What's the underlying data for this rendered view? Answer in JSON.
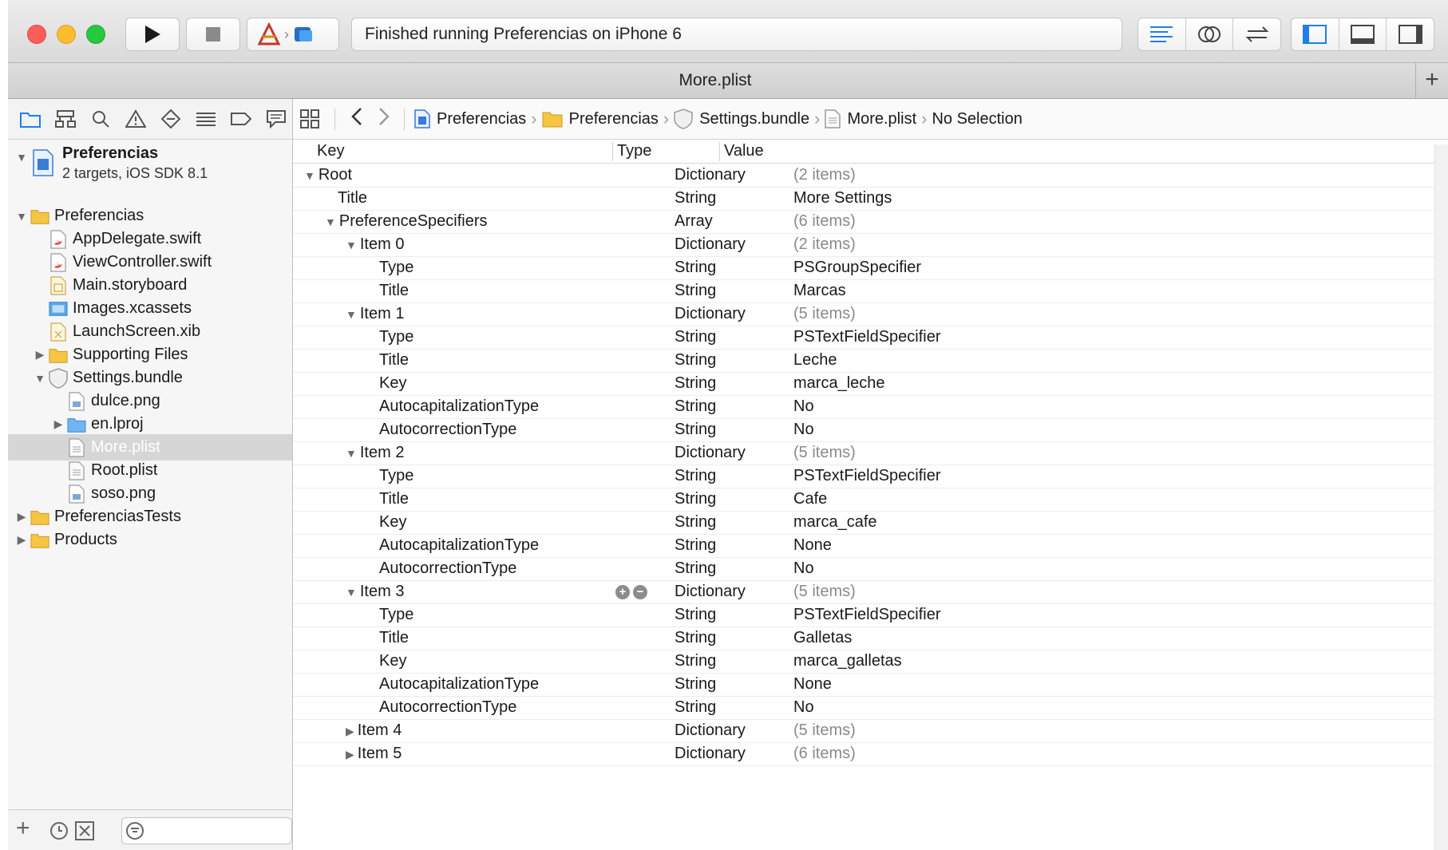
{
  "toolbar": {
    "activity_text": "Finished running Preferencias on iPhone 6"
  },
  "tab": {
    "title": "More.plist",
    "add_label": "+"
  },
  "navigator": {
    "project": {
      "name": "Preferencias",
      "subtitle": "2 targets, iOS SDK 8.1"
    },
    "items": [
      {
        "label": "Preferencias",
        "level": 1,
        "icon": "folder-icon",
        "disclosure": "open"
      },
      {
        "label": "AppDelegate.swift",
        "level": 2,
        "icon": "swift-file-icon",
        "disclosure": "none"
      },
      {
        "label": "ViewController.swift",
        "level": 2,
        "icon": "swift-file-icon",
        "disclosure": "none"
      },
      {
        "label": "Main.storyboard",
        "level": 2,
        "icon": "storyboard-icon",
        "disclosure": "none"
      },
      {
        "label": "Images.xcassets",
        "level": 2,
        "icon": "assets-icon",
        "disclosure": "none"
      },
      {
        "label": "LaunchScreen.xib",
        "level": 2,
        "icon": "xib-icon",
        "disclosure": "none"
      },
      {
        "label": "Supporting Files",
        "level": 2,
        "icon": "folder-icon",
        "disclosure": "closed"
      },
      {
        "label": "Settings.bundle",
        "level": 2,
        "icon": "bundle-icon",
        "disclosure": "open"
      },
      {
        "label": "dulce.png",
        "level": 3,
        "icon": "image-file-icon",
        "disclosure": "none"
      },
      {
        "label": "en.lproj",
        "level": 3,
        "icon": "blue-folder-icon",
        "disclosure": "closed"
      },
      {
        "label": "More.plist",
        "level": 3,
        "icon": "plist-file-icon",
        "disclosure": "none",
        "selected": true
      },
      {
        "label": "Root.plist",
        "level": 3,
        "icon": "plist-file-icon",
        "disclosure": "none"
      },
      {
        "label": "soso.png",
        "level": 3,
        "icon": "image-file-icon",
        "disclosure": "none"
      },
      {
        "label": "PreferenciasTests",
        "level": 1,
        "icon": "folder-icon",
        "disclosure": "closed"
      },
      {
        "label": "Products",
        "level": 1,
        "icon": "folder-icon",
        "disclosure": "closed"
      }
    ],
    "add_label": "+"
  },
  "jumpbar": {
    "crumbs": [
      "Preferencias",
      "Preferencias",
      "Settings.bundle",
      "More.plist",
      "No Selection"
    ]
  },
  "plist": {
    "headers": {
      "key": "Key",
      "type": "Type",
      "value": "Value"
    },
    "rows": [
      {
        "key": "Root",
        "level": 0,
        "disclosure": "open",
        "type": "Dictionary",
        "value": "(2 items)",
        "gray": true
      },
      {
        "key": "Title",
        "level": 1,
        "disclosure": "none",
        "type": "String",
        "value": "More Settings",
        "gray": false
      },
      {
        "key": "PreferenceSpecifiers",
        "level": 1,
        "disclosure": "open",
        "type": "Array",
        "value": "(6 items)",
        "gray": true
      },
      {
        "key": "Item 0",
        "level": 2,
        "disclosure": "open",
        "type": "Dictionary",
        "value": "(2 items)",
        "gray": true
      },
      {
        "key": "Type",
        "level": 3,
        "disclosure": "none",
        "type": "String",
        "value": "PSGroupSpecifier",
        "gray": false
      },
      {
        "key": "Title",
        "level": 3,
        "disclosure": "none",
        "type": "String",
        "value": "Marcas",
        "gray": false
      },
      {
        "key": "Item 1",
        "level": 2,
        "disclosure": "open",
        "type": "Dictionary",
        "value": "(5 items)",
        "gray": true
      },
      {
        "key": "Type",
        "level": 3,
        "disclosure": "none",
        "type": "String",
        "value": "PSTextFieldSpecifier",
        "gray": false
      },
      {
        "key": "Title",
        "level": 3,
        "disclosure": "none",
        "type": "String",
        "value": "Leche",
        "gray": false
      },
      {
        "key": "Key",
        "level": 3,
        "disclosure": "none",
        "type": "String",
        "value": "marca_leche",
        "gray": false
      },
      {
        "key": "AutocapitalizationType",
        "level": 3,
        "disclosure": "none",
        "type": "String",
        "value": "No",
        "gray": false
      },
      {
        "key": "AutocorrectionType",
        "level": 3,
        "disclosure": "none",
        "type": "String",
        "value": "No",
        "gray": false
      },
      {
        "key": "Item 2",
        "level": 2,
        "disclosure": "open",
        "type": "Dictionary",
        "value": "(5 items)",
        "gray": true
      },
      {
        "key": "Type",
        "level": 3,
        "disclosure": "none",
        "type": "String",
        "value": "PSTextFieldSpecifier",
        "gray": false
      },
      {
        "key": "Title",
        "level": 3,
        "disclosure": "none",
        "type": "String",
        "value": "Cafe",
        "gray": false
      },
      {
        "key": "Key",
        "level": 3,
        "disclosure": "none",
        "type": "String",
        "value": "marca_cafe",
        "gray": false
      },
      {
        "key": "AutocapitalizationType",
        "level": 3,
        "disclosure": "none",
        "type": "String",
        "value": "None",
        "gray": false
      },
      {
        "key": "AutocorrectionType",
        "level": 3,
        "disclosure": "none",
        "type": "String",
        "value": "No",
        "gray": false
      },
      {
        "key": "Item 3",
        "level": 2,
        "disclosure": "open",
        "type": "Dictionary",
        "value": "(5 items)",
        "gray": true,
        "row_buttons": true
      },
      {
        "key": "Type",
        "level": 3,
        "disclosure": "none",
        "type": "String",
        "value": "PSTextFieldSpecifier",
        "gray": false
      },
      {
        "key": "Title",
        "level": 3,
        "disclosure": "none",
        "type": "String",
        "value": "Galletas",
        "gray": false
      },
      {
        "key": "Key",
        "level": 3,
        "disclosure": "none",
        "type": "String",
        "value": "marca_galletas",
        "gray": false
      },
      {
        "key": "AutocapitalizationType",
        "level": 3,
        "disclosure": "none",
        "type": "String",
        "value": "None",
        "gray": false
      },
      {
        "key": "AutocorrectionType",
        "level": 3,
        "disclosure": "none",
        "type": "String",
        "value": "No",
        "gray": false
      },
      {
        "key": "Item 4",
        "level": 2,
        "disclosure": "closed",
        "type": "Dictionary",
        "value": "(5 items)",
        "gray": true
      },
      {
        "key": "Item 5",
        "level": 2,
        "disclosure": "closed",
        "type": "Dictionary",
        "value": "(6 items)",
        "gray": true
      }
    ]
  },
  "colors": {
    "folder": "#f5c543",
    "accent": "#1f7ee8",
    "selection": "#d6d6d6"
  }
}
